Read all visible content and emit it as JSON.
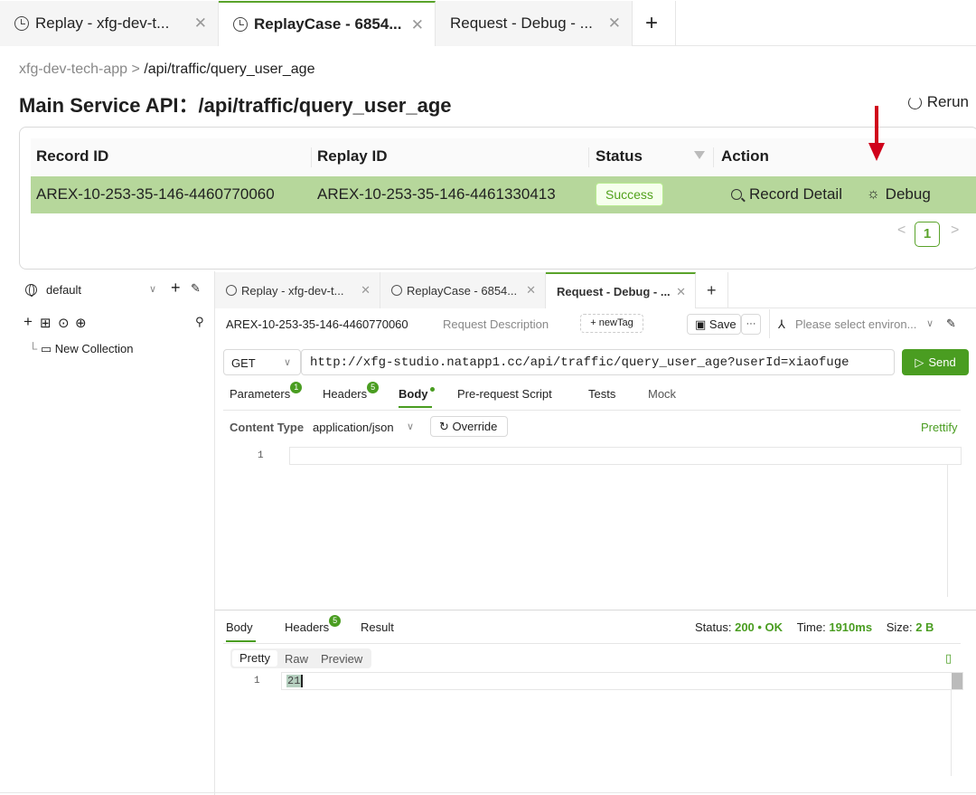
{
  "top_tabs": [
    {
      "label": "Replay - xfg-dev-t..."
    },
    {
      "label": "ReplayCase - 6854..."
    },
    {
      "label": "Request - Debug - ..."
    }
  ],
  "breadcrumb": {
    "parent": "xfg-dev-tech-app",
    "separator": ">",
    "current": "/api/traffic/query_user_age"
  },
  "title": {
    "prefix": "Main Service API：",
    "path": "/api/traffic/query_user_age"
  },
  "rerun_label": "Rerun",
  "table": {
    "headers": {
      "record_id": "Record ID",
      "replay_id": "Replay ID",
      "status": "Status",
      "action": "Action"
    },
    "row": {
      "record_id": "AREX-10-253-35-146-4460770060",
      "replay_id": "AREX-10-253-35-146-4461330413",
      "status": "Success",
      "record_detail": "Record Detail",
      "debug": "Debug"
    },
    "pagination": {
      "prev": "<",
      "page": "1",
      "next": ">"
    }
  },
  "sidebar": {
    "workspace": "default",
    "tree": [
      {
        "label": "New Collection"
      }
    ]
  },
  "inner_tabs": [
    {
      "label": "Replay - xfg-dev-t..."
    },
    {
      "label": "ReplayCase - 6854..."
    },
    {
      "label": "Request - Debug - ..."
    }
  ],
  "request": {
    "name": "AREX-10-253-35-146-4460770060",
    "description_placeholder": "Request Description",
    "new_tag": "+ newTag",
    "save": "Save",
    "more": "···",
    "env_placeholder": "Please select environ...",
    "method": "GET",
    "url": "http://xfg-studio.natapp1.cc/api/traffic/query_user_age?userId=xiaofuge",
    "send": "Send",
    "tabs": {
      "parameters": "Parameters",
      "parameters_count": "1",
      "headers": "Headers",
      "headers_count": "5",
      "body": "Body",
      "prerequest": "Pre-request Script",
      "tests": "Tests",
      "mock": "Mock"
    },
    "content_type_label": "Content Type",
    "content_type_value": "application/json",
    "override": "Override",
    "prettify": "Prettify",
    "editor_line": "1"
  },
  "response": {
    "tabs": {
      "body": "Body",
      "headers": "Headers",
      "headers_count": "5",
      "result": "Result"
    },
    "status_label": "Status:",
    "status_value": "200 • OK",
    "time_label": "Time:",
    "time_value": "1910ms",
    "size_label": "Size:",
    "size_value": "2 B",
    "views": {
      "pretty": "Pretty",
      "raw": "Raw",
      "preview": "Preview"
    },
    "line_number": "1",
    "content": "21"
  },
  "colors": {
    "accent": "#4a9d21",
    "row_highlight": "#b6d79b",
    "arrow": "#d0021b"
  }
}
